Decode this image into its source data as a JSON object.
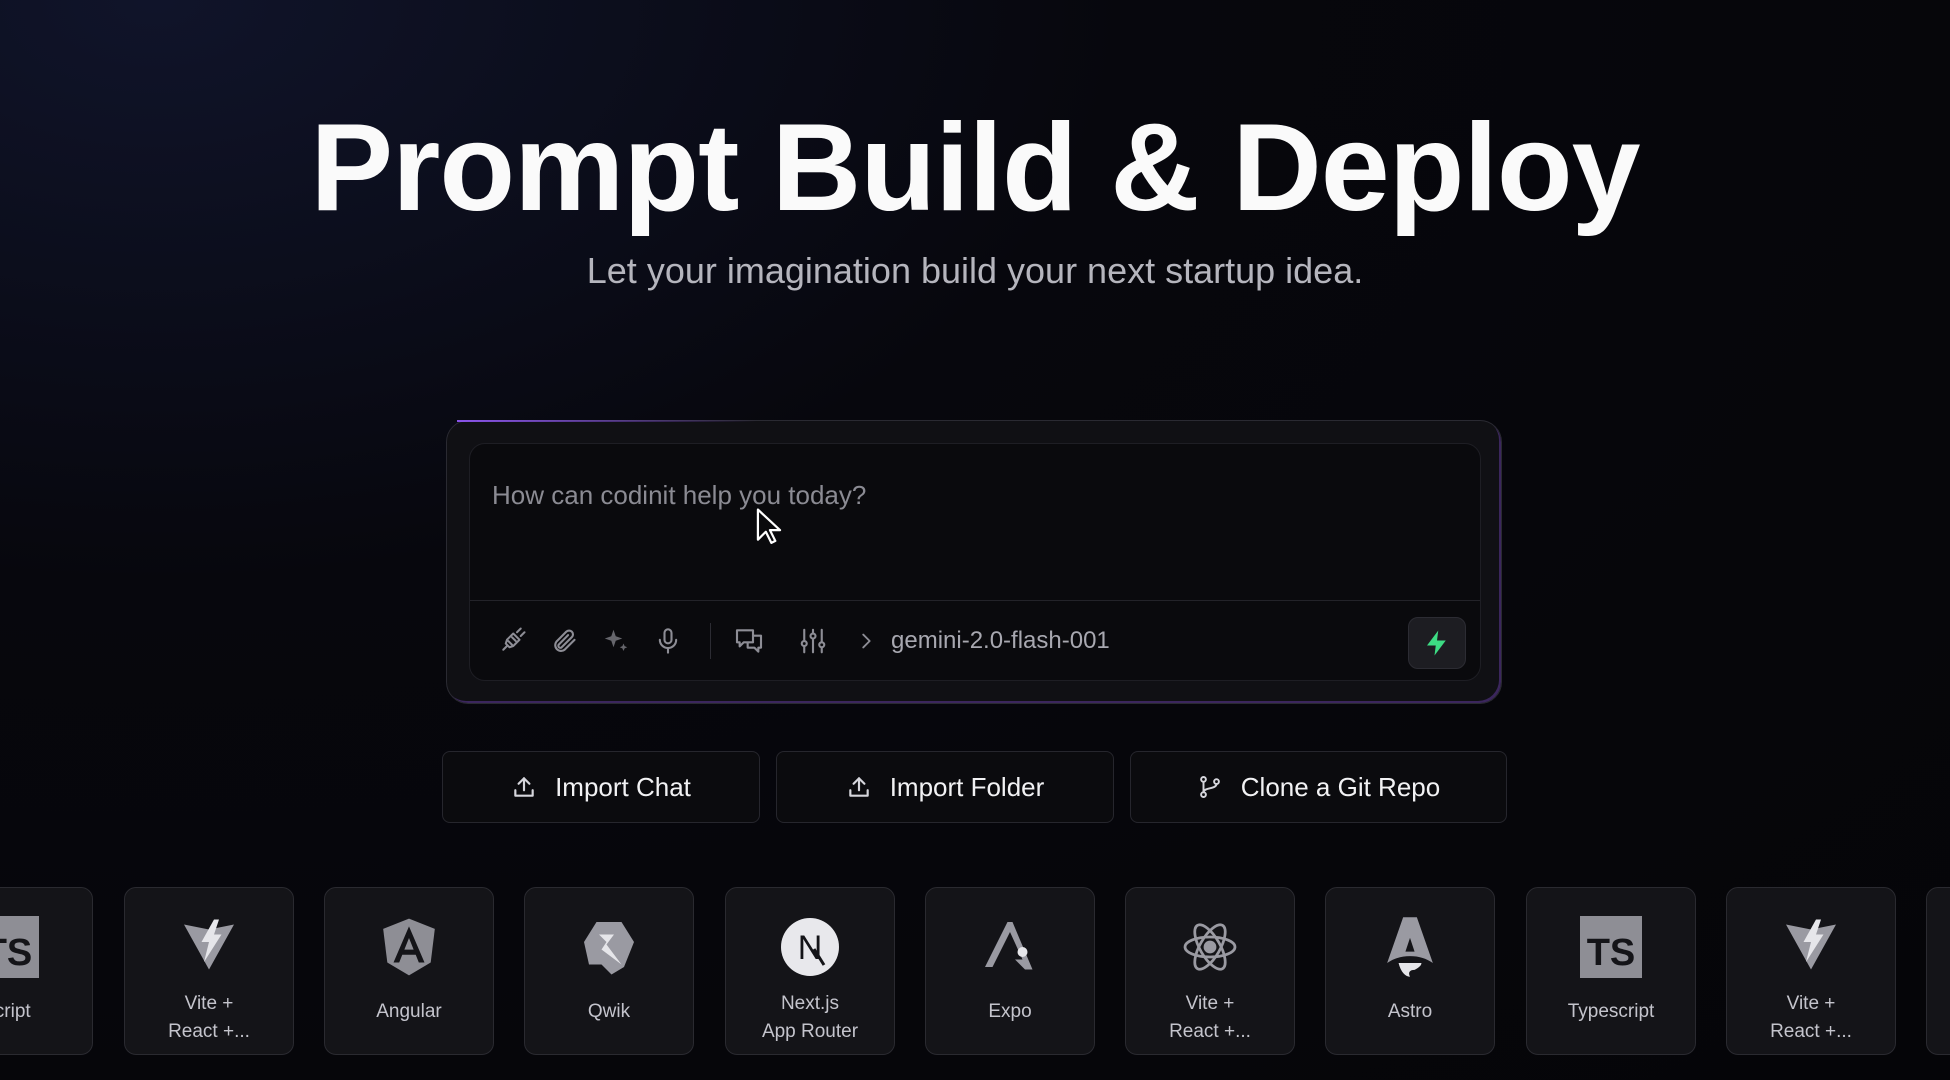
{
  "hero": {
    "title": "Prompt Build & Deploy",
    "subtitle": "Let your imagination build your next startup idea."
  },
  "prompt": {
    "placeholder": "How can codinit help you today?",
    "model": "gemini-2.0-flash-001",
    "tools": [
      "plug-icon",
      "paperclip-icon",
      "sparkles-icon",
      "microphone-icon",
      "chat-icon",
      "sliders-icon"
    ],
    "accent": "#3ddc84"
  },
  "actions": [
    {
      "label": "Import Chat",
      "icon": "upload-icon"
    },
    {
      "label": "Import Folder",
      "icon": "upload-icon"
    },
    {
      "label": "Clone a Git Repo",
      "icon": "git-branch-icon"
    }
  ],
  "templates": [
    {
      "line1": "script",
      "line2": "",
      "logo": "ts-logo-icon"
    },
    {
      "line1": "Vite +",
      "line2": "React +...",
      "logo": "vite-logo-icon"
    },
    {
      "line1": "Angular",
      "line2": "",
      "logo": "angular-logo-icon"
    },
    {
      "line1": "Qwik",
      "line2": "",
      "logo": "qwik-logo-icon"
    },
    {
      "line1": "Next.js",
      "line2": "App Router",
      "logo": "nextjs-logo-icon"
    },
    {
      "line1": "Expo",
      "line2": "",
      "logo": "expo-logo-icon"
    },
    {
      "line1": "Vite +",
      "line2": "React +...",
      "logo": "react-logo-icon"
    },
    {
      "line1": "Astro",
      "line2": "",
      "logo": "astro-logo-icon"
    },
    {
      "line1": "Typescript",
      "line2": "",
      "logo": "ts-logo-icon"
    },
    {
      "line1": "Vite +",
      "line2": "React +...",
      "logo": "vite-logo-icon"
    }
  ],
  "ts_logo_text": "TS",
  "nextjs_logo_text": "N"
}
